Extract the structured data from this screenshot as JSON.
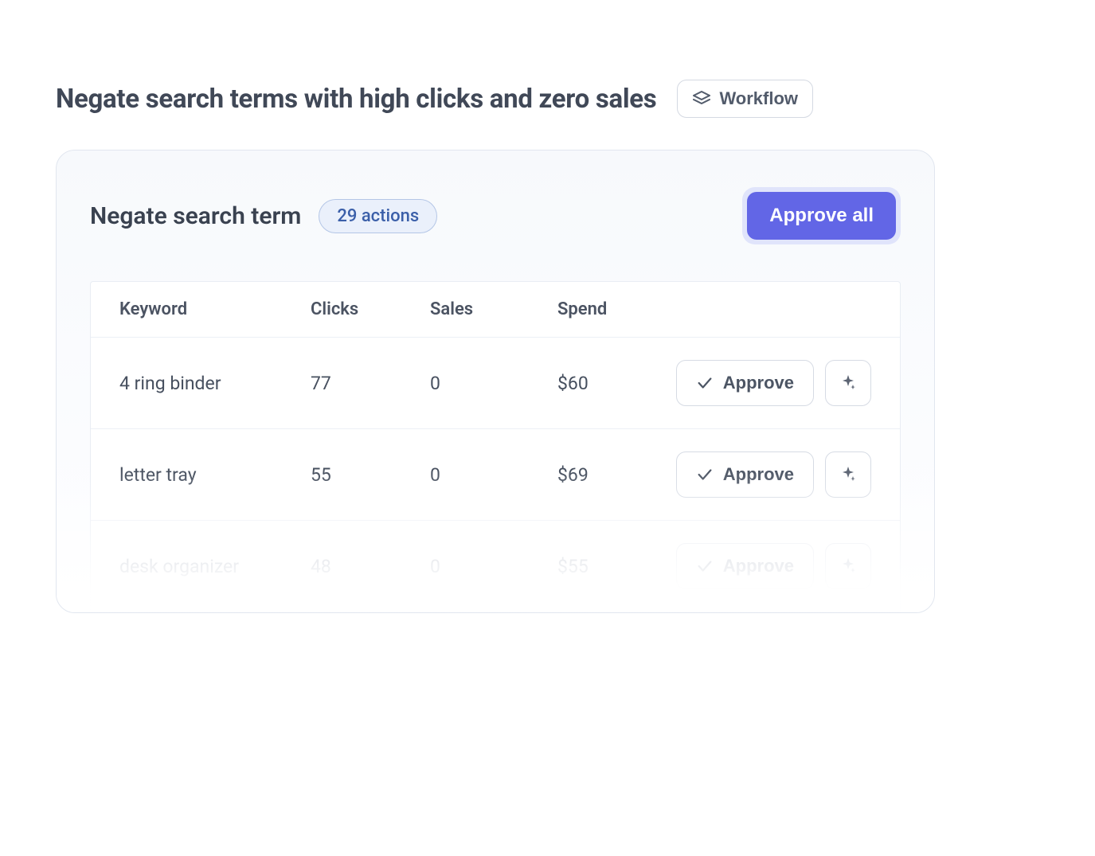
{
  "header": {
    "title": "Negate search terms with high clicks and zero sales",
    "workflow_label": "Workflow"
  },
  "card": {
    "title": "Negate search term",
    "actions_badge": "29 actions",
    "approve_all_label": "Approve all",
    "columns": {
      "keyword": "Keyword",
      "clicks": "Clicks",
      "sales": "Sales",
      "spend": "Spend"
    },
    "approve_label": "Approve",
    "rows": [
      {
        "keyword": "4 ring binder",
        "clicks": "77",
        "sales": "0",
        "spend": "$60"
      },
      {
        "keyword": "letter tray",
        "clicks": "55",
        "sales": "0",
        "spend": "$69"
      },
      {
        "keyword": "desk organizer",
        "clicks": "48",
        "sales": "0",
        "spend": "$55"
      }
    ]
  }
}
